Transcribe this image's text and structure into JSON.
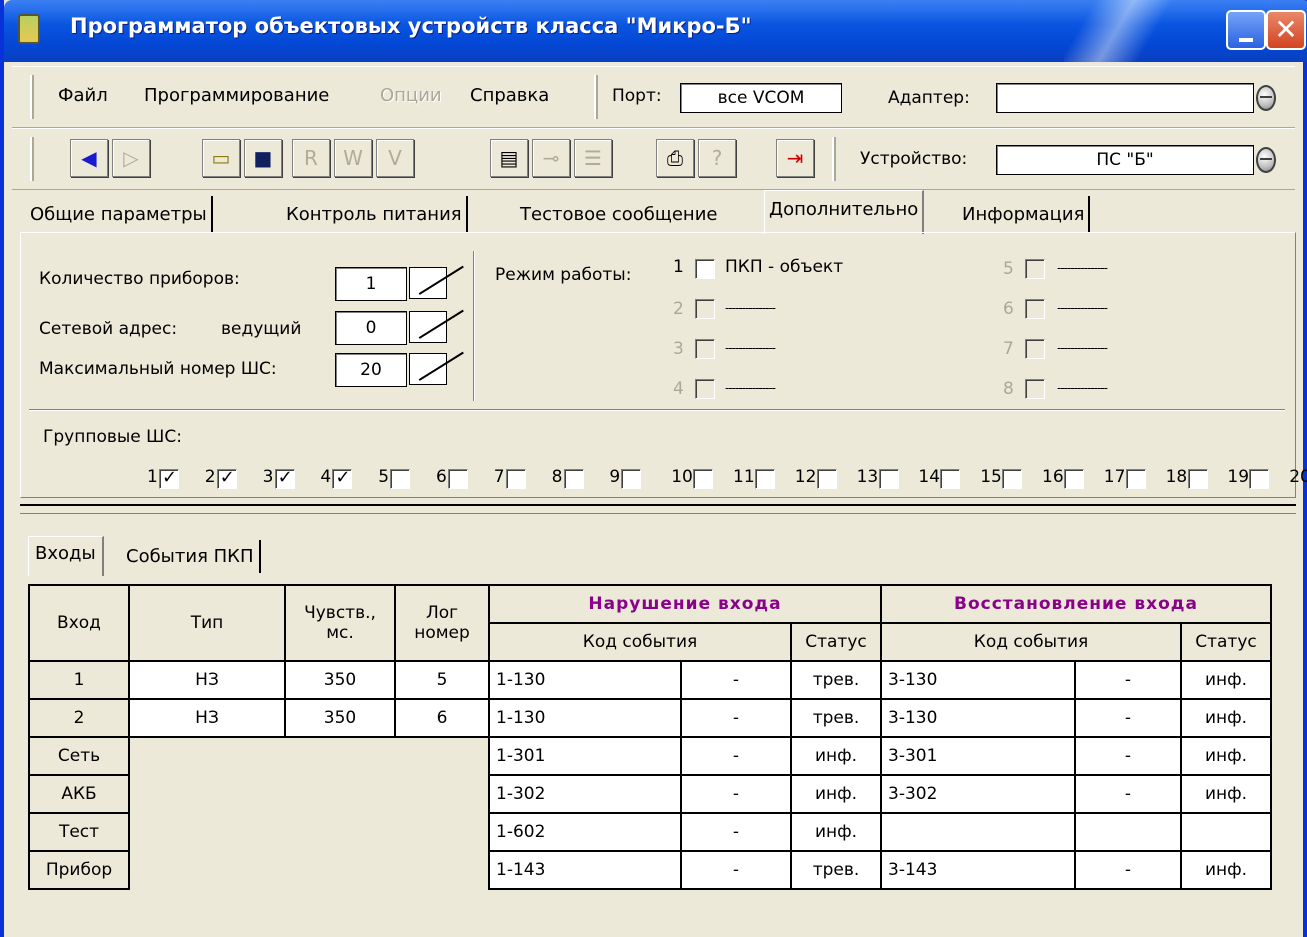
{
  "window": {
    "title": "Программатор объектовых устройств класса \"Микро-Б\"",
    "close": "✕"
  },
  "menu": {
    "file": "Файл",
    "programming": "Программирование",
    "options": "Опции",
    "help": "Справка"
  },
  "port": {
    "label": "Порт:",
    "value": "все VCOM"
  },
  "adapter": {
    "label": "Адаптер:",
    "value": ""
  },
  "device": {
    "label": "Устройство:",
    "value": "ПС \"Б\""
  },
  "toolbar": {
    "icons": [
      "back-arrow-icon",
      "forward-arrow-icon",
      "open-folder-icon",
      "save-disk-icon",
      "read-icon",
      "write-icon",
      "verify-icon",
      "monitor-icon",
      "key-icon",
      "list-icon",
      "print-icon",
      "help-icon",
      "exit-icon"
    ]
  },
  "tabs": [
    "Общие параметры",
    "Контроль питания",
    "Тестовое сообщение",
    "Дополнительно",
    "Информация"
  ],
  "general": {
    "count_label": "Количество приборов:",
    "count_value": "1",
    "net_label": "Сетевой адрес:",
    "net_role": "ведущий",
    "net_value": "0",
    "max_label": "Максимальный номер ШС:",
    "max_value": "20"
  },
  "modes": {
    "label": "Режим работы:",
    "items": [
      {
        "n": "1",
        "text": "ПКП - объект"
      },
      {
        "n": "2",
        "text": "---------------"
      },
      {
        "n": "3",
        "text": "---------------"
      },
      {
        "n": "4",
        "text": "---------------"
      },
      {
        "n": "5",
        "text": "---------------"
      },
      {
        "n": "6",
        "text": "---------------"
      },
      {
        "n": "7",
        "text": "---------------"
      },
      {
        "n": "8",
        "text": "---------------"
      }
    ]
  },
  "group": {
    "label": "Групповые ШС:",
    "checked": [
      1,
      2,
      3,
      4
    ]
  },
  "bottom_tabs": [
    "Входы",
    "События ПКП"
  ],
  "table": {
    "h_input": "Вход",
    "h_type": "Тип",
    "h_sens": "Чувств., мс.",
    "h_log": "Лог номер",
    "h_violation": "Нарушение входа",
    "h_restore": "Восстановление входа",
    "h_code": "Код события",
    "h_status": "Статус",
    "rows": [
      {
        "input": "1",
        "type": "НЗ",
        "sens": "350",
        "log": "5",
        "v_code": "1-130",
        "v_dash": "-",
        "v_status": "трев.",
        "r_code": "3-130",
        "r_dash": "-",
        "r_status": "инф."
      },
      {
        "input": "2",
        "type": "НЗ",
        "sens": "350",
        "log": "6",
        "v_code": "1-130",
        "v_dash": "-",
        "v_status": "трев.",
        "r_code": "3-130",
        "r_dash": "-",
        "r_status": "инф."
      },
      {
        "input": "Сеть",
        "type": "",
        "sens": "",
        "log": "",
        "v_code": "1-301",
        "v_dash": "-",
        "v_status": "инф.",
        "r_code": "3-301",
        "r_dash": "-",
        "r_status": "инф."
      },
      {
        "input": "АКБ",
        "type": "",
        "sens": "",
        "log": "",
        "v_code": "1-302",
        "v_dash": "-",
        "v_status": "инф.",
        "r_code": "3-302",
        "r_dash": "-",
        "r_status": "инф."
      },
      {
        "input": "Тест",
        "type": "",
        "sens": "",
        "log": "",
        "v_code": "1-602",
        "v_dash": "-",
        "v_status": "инф.",
        "r_code": "",
        "r_dash": "",
        "r_status": ""
      },
      {
        "input": "Прибор",
        "type": "",
        "sens": "",
        "log": "",
        "v_code": "1-143",
        "v_dash": "-",
        "v_status": "трев.",
        "r_code": "3-143",
        "r_dash": "-",
        "r_status": "инф."
      }
    ]
  },
  "colors": {
    "title_bar": "#0a55e0",
    "header_accent": "#8b008b"
  }
}
